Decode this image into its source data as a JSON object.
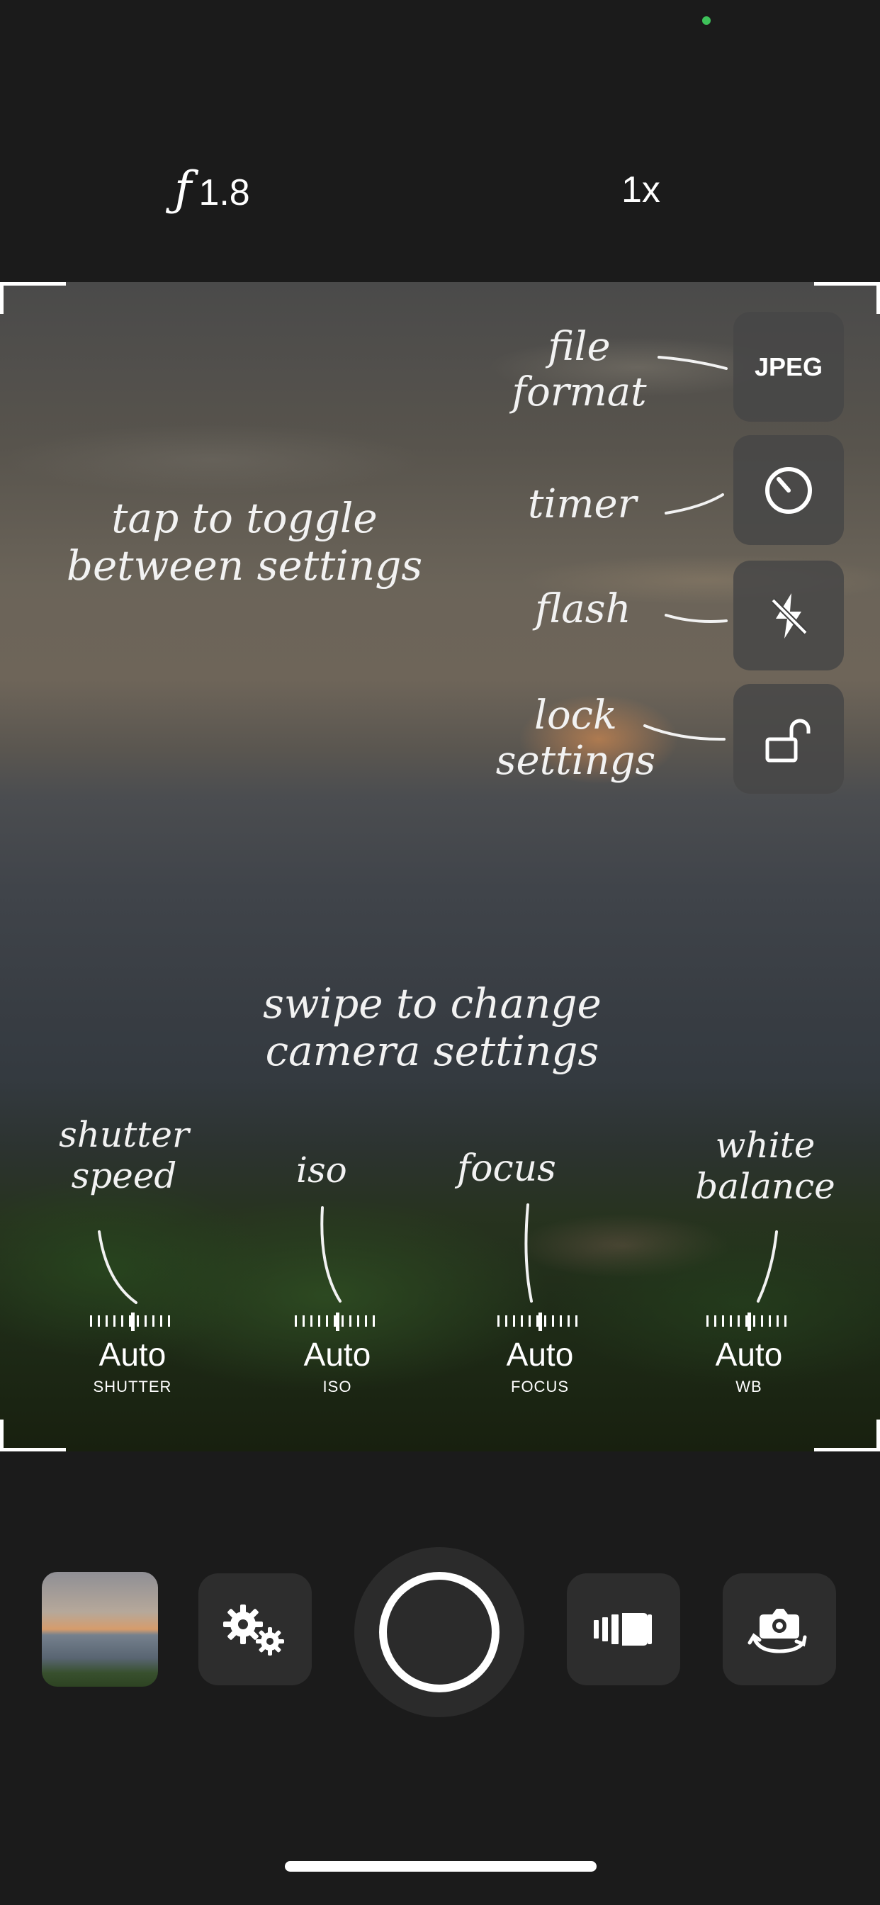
{
  "top_bar": {
    "aperture_symbol": "ƒ",
    "aperture_value": "1.8",
    "zoom": "1x"
  },
  "side_controls": {
    "file_format": "JPEG"
  },
  "annotations": {
    "file_format": "file format",
    "timer": "timer",
    "flash": "flash",
    "lock_settings": "lock settings",
    "tap_toggle": "tap to toggle between settings",
    "swipe_change": "swipe to change camera settings",
    "shutter_speed": "shutter speed",
    "iso": "iso",
    "focus": "focus",
    "white_balance": "white balance"
  },
  "dials": [
    {
      "value": "Auto",
      "label": "SHUTTER"
    },
    {
      "value": "Auto",
      "label": "ISO"
    },
    {
      "value": "Auto",
      "label": "FOCUS"
    },
    {
      "value": "Auto",
      "label": "WB"
    }
  ],
  "icons": [
    "gear-icon",
    "timer-icon",
    "flash-off-icon",
    "unlock-icon",
    "shutter-icon",
    "switch-camera-icon",
    "video-icon"
  ],
  "colors": {
    "status_dot": "#3ec25a",
    "background": "#1b1b1b"
  }
}
